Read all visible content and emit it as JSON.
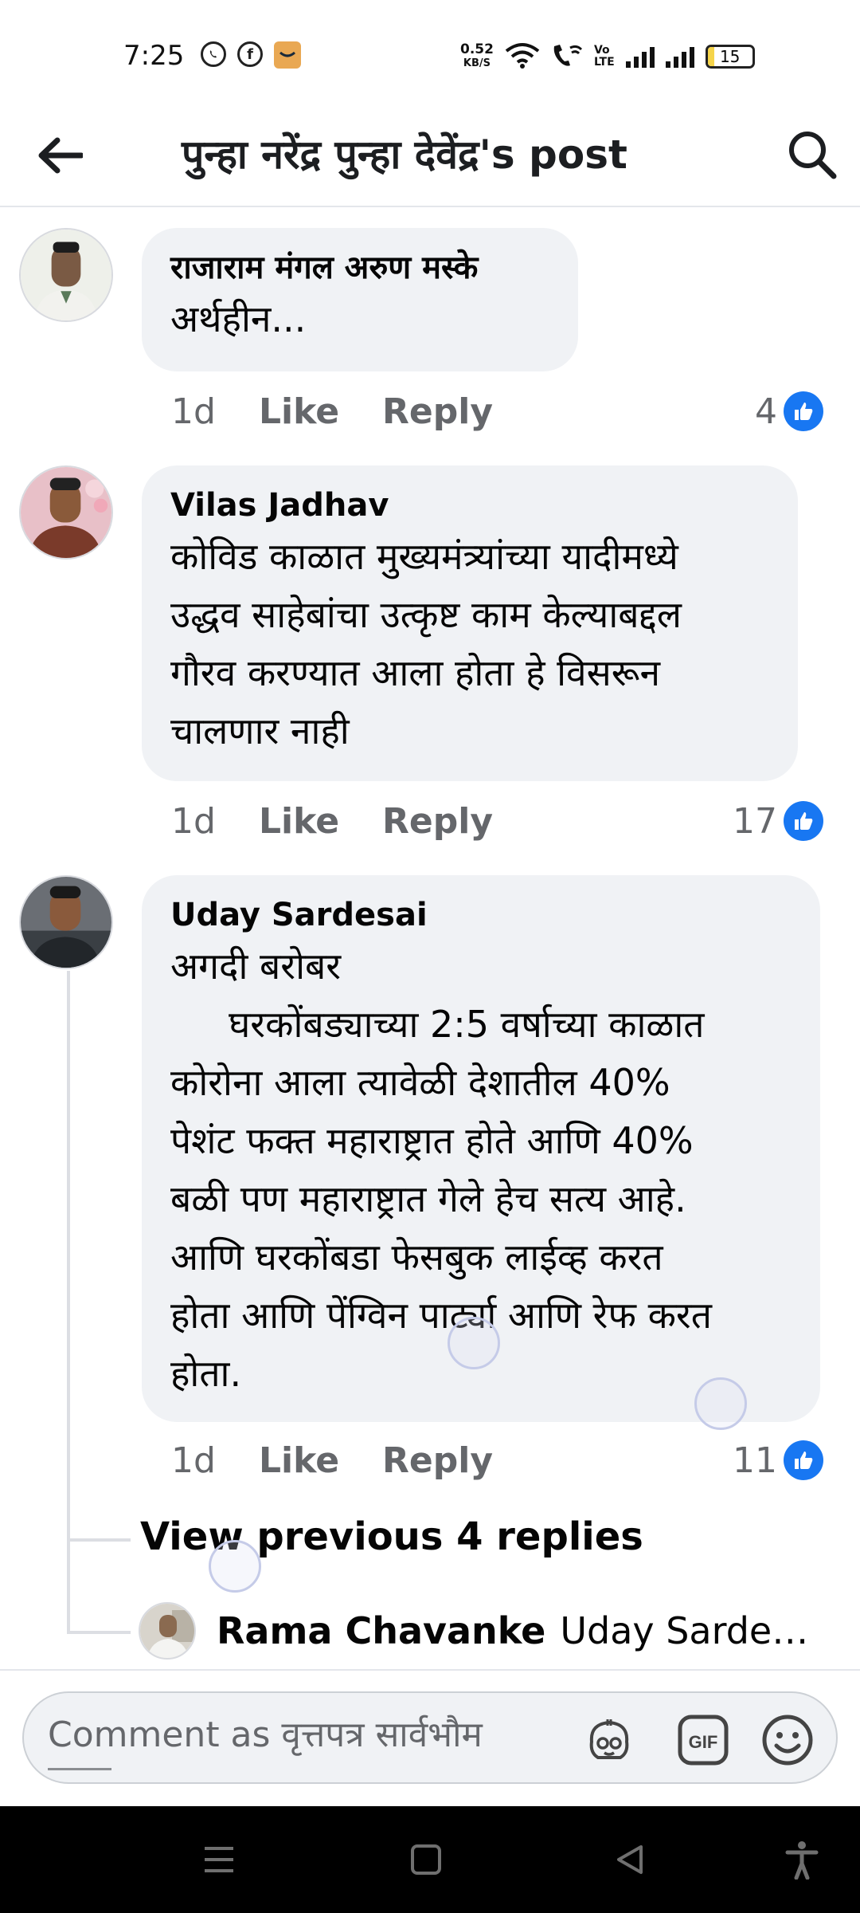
{
  "status_bar": {
    "time": "7:25",
    "net_speed_value": "0.52",
    "net_speed_unit": "KB/S",
    "volte_top": "Vo",
    "volte_bottom": "LTE",
    "battery_level": "15",
    "icons": [
      "whatsapp-icon",
      "facebook-icon",
      "amazon-icon",
      "wifi-icon",
      "wifi-call-icon",
      "volte-icon",
      "signal-icon",
      "signal-icon",
      "battery-icon"
    ]
  },
  "header": {
    "title": "पुन्हा नरेंद्र पुन्हा देवेंद्र's post",
    "icons": [
      "back-arrow-icon",
      "search-icon"
    ]
  },
  "comments": [
    {
      "author": "राजाराम मंगल अरुण मस्के",
      "text": "अर्थहीन...",
      "time": "1d",
      "like_label": "Like",
      "reply_label": "Reply",
      "reaction_count": "4"
    },
    {
      "author": "Vilas Jadhav",
      "text": "कोविड काळात मुख्यमंत्र्यांच्या यादीमध्ये\nउद्धव साहेबांचा उत्कृष्ट काम केल्याबद्दल\nगौरव करण्यात आला होता हे विसरून\nचालणार नाही",
      "time": "1d",
      "like_label": "Like",
      "reply_label": "Reply",
      "reaction_count": "17"
    },
    {
      "author": "Uday Sardesai",
      "text": "अगदी बरोबर\n     घरकोंबड्याच्या 2:5 वर्षाच्या काळात\nकोरोना आला त्यावेळी देशातील 40%\nपेशंट फक्त महाराष्ट्रात होते आणि 40%\nबळी पण महाराष्ट्रात गेले हेच सत्य आहे.\nआणि घरकोंबडा फेसबुक लाईव्ह करत\nहोता आणि पेंग्विन पार्ट्या आणि रेफ करत\nहोता.",
      "time": "1d",
      "like_label": "Like",
      "reply_label": "Reply",
      "reaction_count": "11"
    }
  ],
  "replies": {
    "view_previous": "View previous 4 replies",
    "latest_author": "Rama Chavanke",
    "latest_snippet": "Uday Sardes..."
  },
  "composer": {
    "placeholder": "Comment as वृत्तपत्र सार्वभौम",
    "icons": [
      "avatar-sticker-icon",
      "gif-icon",
      "emoji-icon"
    ]
  },
  "nav_bar": {
    "icons": [
      "menu-icon",
      "home-square-icon",
      "back-triangle-icon",
      "accessibility-icon"
    ]
  },
  "colors": {
    "accent": "#1877f2",
    "bubble": "#f0f2f5",
    "secondary_text": "#65676b",
    "nav_bar": "#000000"
  }
}
